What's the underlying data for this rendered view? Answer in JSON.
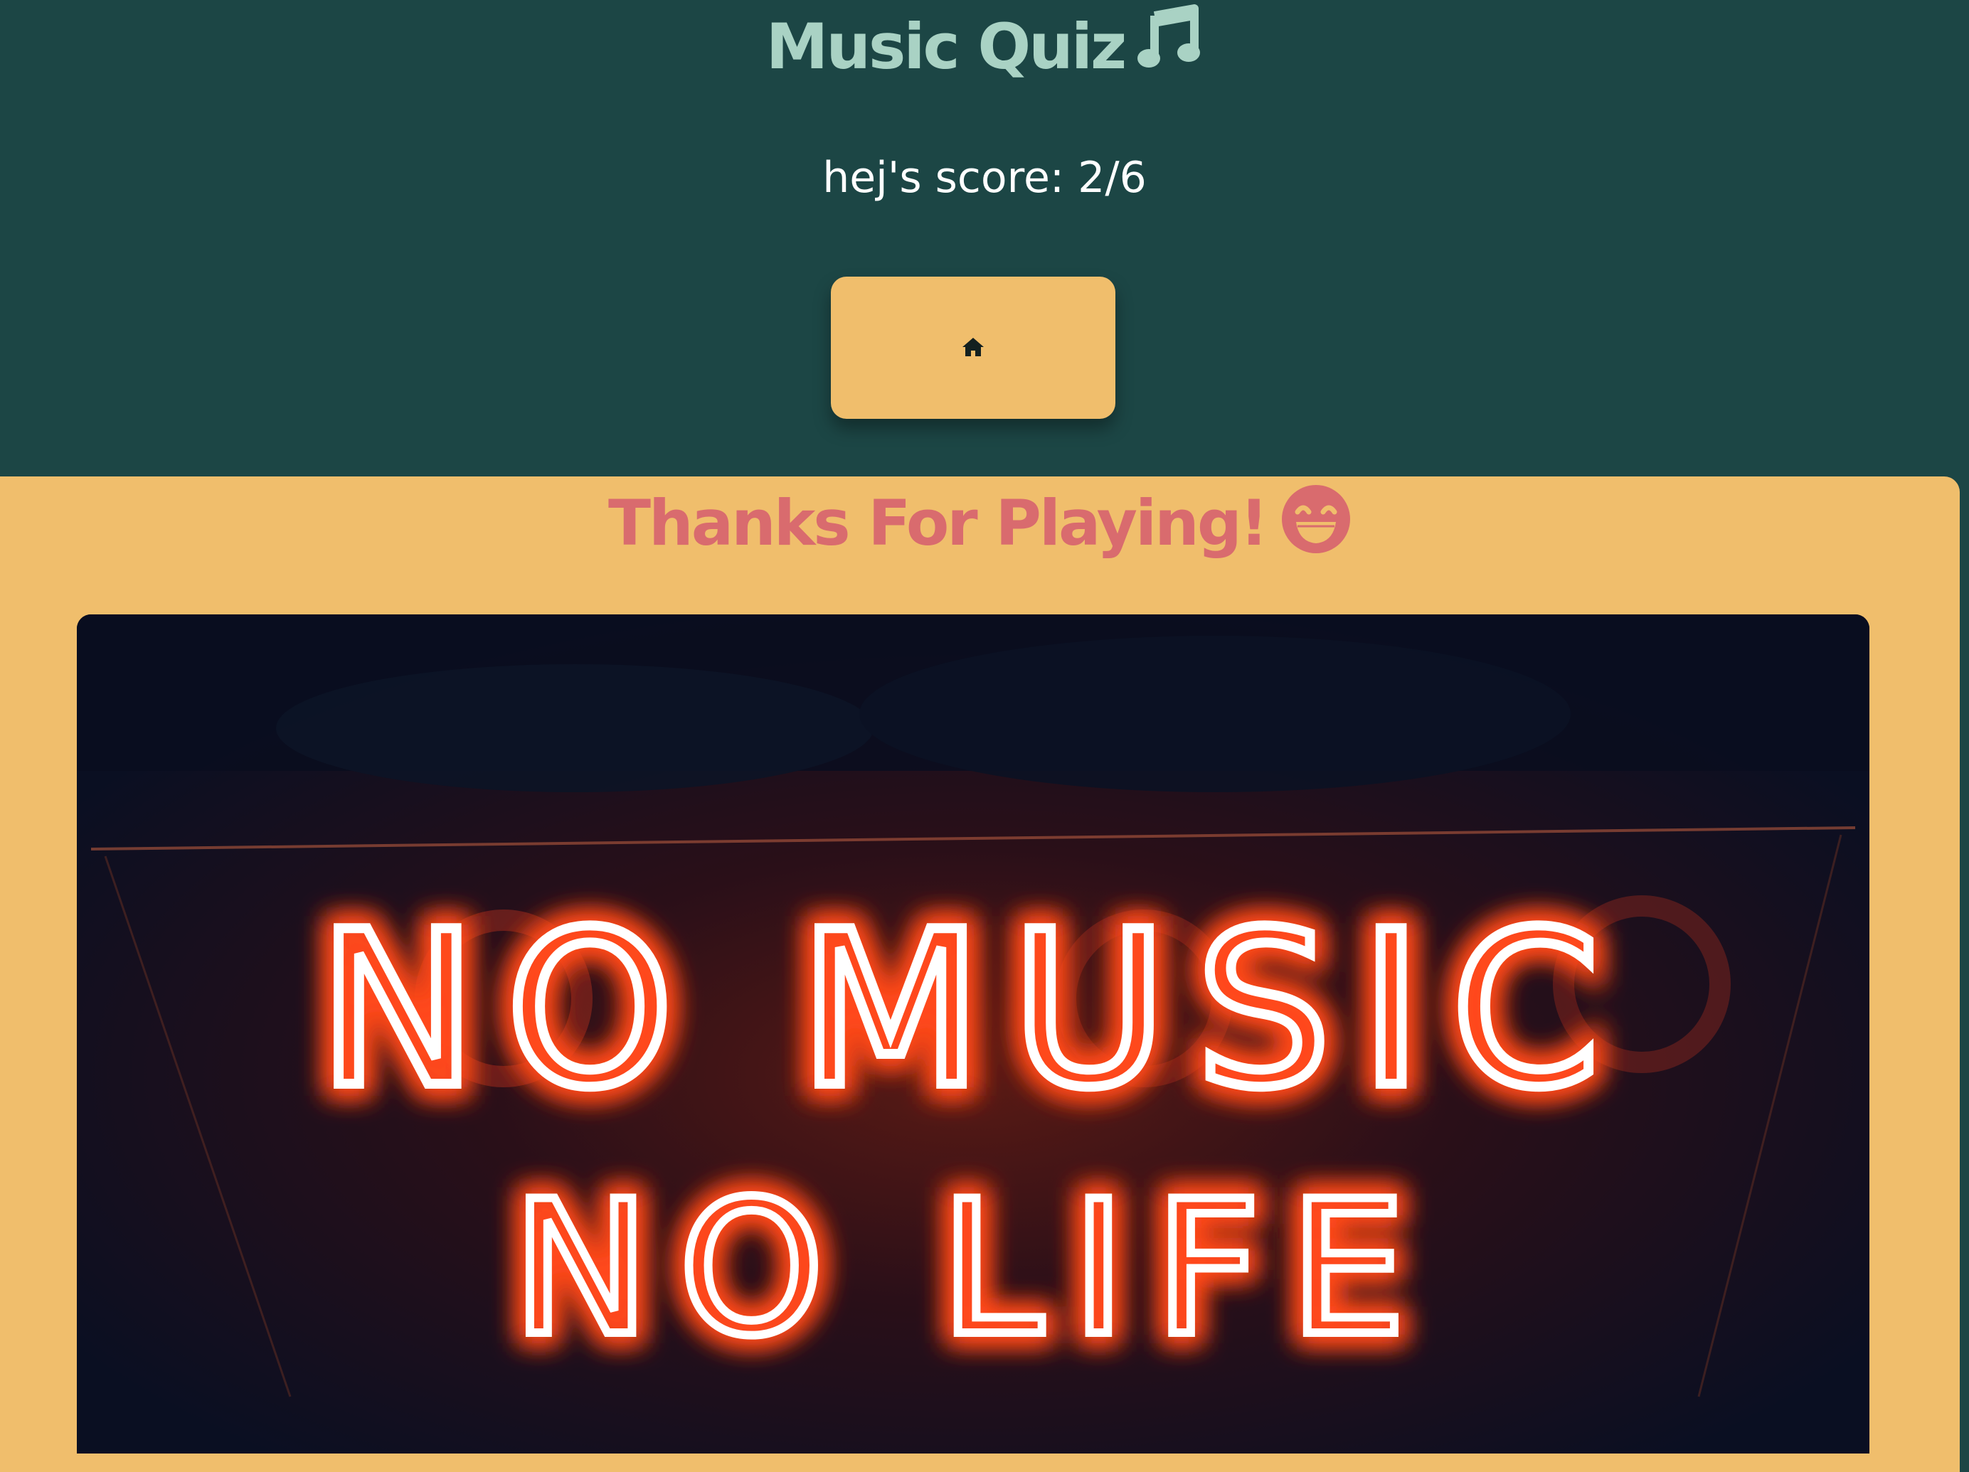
{
  "header": {
    "title": "Music Quiz",
    "title_icon": "music-note-icon",
    "score_text": "hej's score: 2/6",
    "home_button_icon": "home-icon"
  },
  "end_card": {
    "heading": "Thanks For Playing!",
    "heading_icon": "grinning-face-icon",
    "image": {
      "sign_line_1": "NO MUSIC",
      "sign_line_2": "NO LIFE"
    }
  },
  "colors": {
    "background": "#1c4645",
    "title": "#a9d2c4",
    "accent": "#f0be6c",
    "heading": "#d96b6e",
    "score_text": "#ffffff",
    "neon": "#ffffff",
    "neon_glow": "#ff5a2a"
  }
}
